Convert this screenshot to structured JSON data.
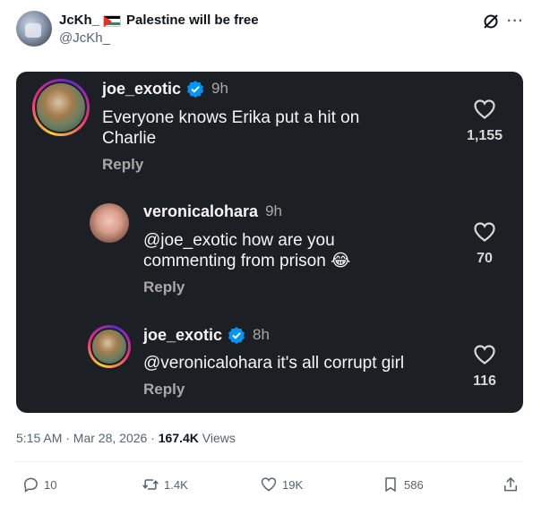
{
  "tweet": {
    "author_name": "JcKh_",
    "author_suffix": "Palestine will be free",
    "handle": "@JcKh_",
    "timestamp": "5:15 AM · Mar 28, 2026 · ",
    "views_count": "167.4K",
    "views_label": " Views"
  },
  "comments": [
    {
      "username": "joe_exotic",
      "verified": true,
      "time": "9h",
      "text_line1": "Everyone knows Erika put a hit on",
      "text_line2": "Charlie",
      "reply_label": "Reply",
      "likes": "1,155"
    },
    {
      "username": "veronicalohara",
      "verified": false,
      "time": "9h",
      "text_line1": "@joe_exotic how are you",
      "text_line2": "commenting from prison 😂",
      "reply_label": "Reply",
      "likes": "70"
    },
    {
      "username": "joe_exotic",
      "verified": true,
      "time": "8h",
      "text_line1": "@veronicalohara it's all corrupt girl",
      "reply_label": "Reply",
      "likes": "116"
    }
  ],
  "actions": {
    "replies": "10",
    "reposts": "1.4K",
    "likes": "19K",
    "bookmarks": "586"
  },
  "colors": {
    "card_bg": "#1c2024",
    "verified_blue": "#0095f6",
    "muted": "#536471"
  },
  "icons": [
    "grok-icon",
    "more-icon",
    "verified-badge-icon",
    "heart-icon",
    "reply-icon",
    "repost-icon",
    "like-icon",
    "bookmark-icon",
    "share-icon"
  ]
}
